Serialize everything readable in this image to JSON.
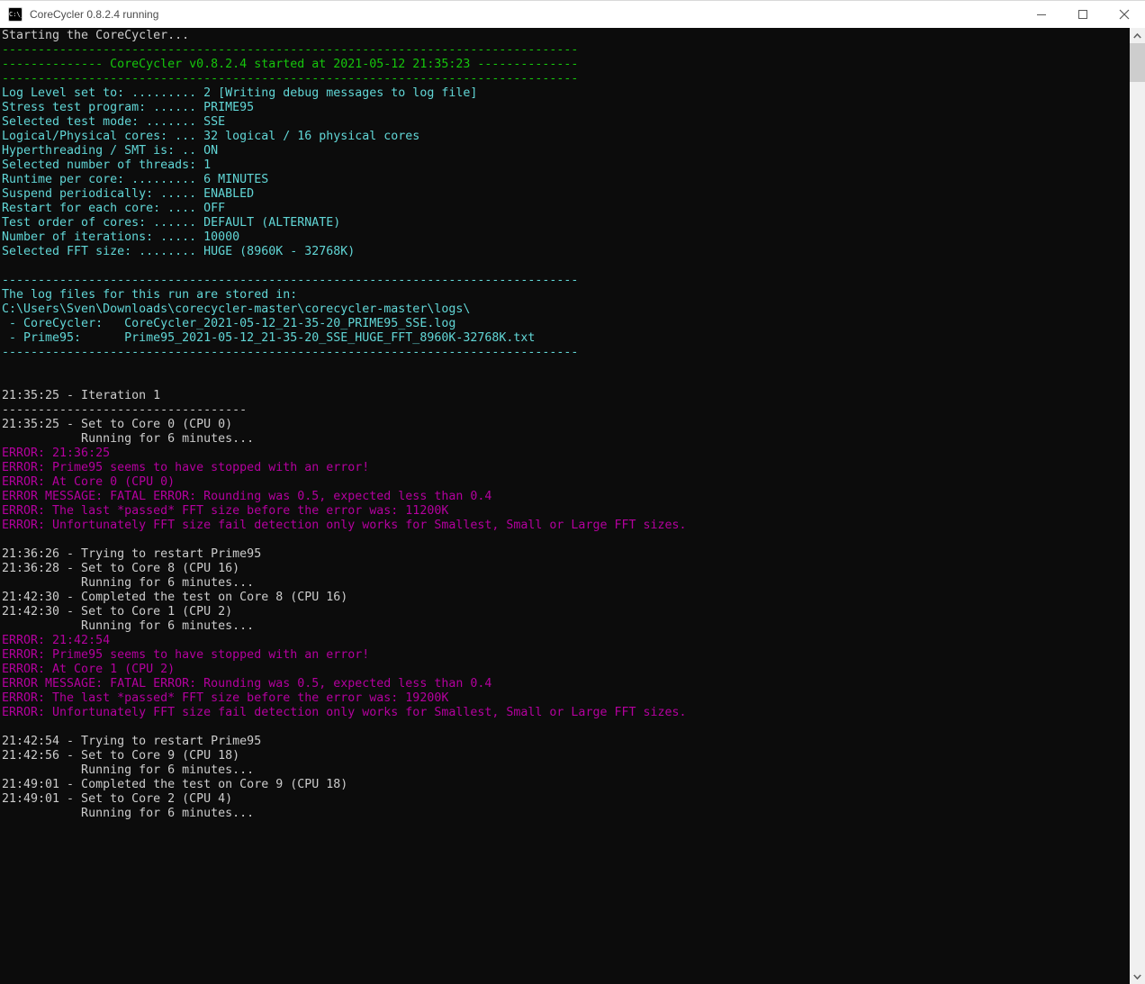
{
  "window": {
    "title": "CoreCycler 0.8.2.4 running",
    "icons": [
      "console-icon",
      "minimize-icon",
      "maximize-icon",
      "close-icon"
    ],
    "icon_label": "C:\\_"
  },
  "palette": {
    "background": "#0c0c0c",
    "titlebar_bg": "#ffffff",
    "title_text": "#4c4c4c",
    "white": "#cccccc",
    "green": "#16c60c",
    "cyan": "#61d6d6",
    "magenta": "#b4009e",
    "scrollbar_track": "#f0f0f0",
    "scrollbar_thumb": "#cdcdcd",
    "scrollbar_arrow": "#606060"
  },
  "console": {
    "lines": [
      {
        "color": "white",
        "text": "Starting the CoreCycler..."
      },
      {
        "color": "green",
        "text": "--------------------------------------------------------------------------------"
      },
      {
        "color": "green",
        "text": "-------------- CoreCycler v0.8.2.4 started at 2021-05-12 21:35:23 --------------"
      },
      {
        "color": "green",
        "text": "--------------------------------------------------------------------------------"
      },
      {
        "color": "cyan",
        "text": "Log Level set to: ......... 2 [Writing debug messages to log file]"
      },
      {
        "color": "cyan",
        "text": "Stress test program: ...... PRIME95"
      },
      {
        "color": "cyan",
        "text": "Selected test mode: ....... SSE"
      },
      {
        "color": "cyan",
        "text": "Logical/Physical cores: ... 32 logical / 16 physical cores"
      },
      {
        "color": "cyan",
        "text": "Hyperthreading / SMT is: .. ON"
      },
      {
        "color": "cyan",
        "text": "Selected number of threads: 1"
      },
      {
        "color": "cyan",
        "text": "Runtime per core: ......... 6 MINUTES"
      },
      {
        "color": "cyan",
        "text": "Suspend periodically: ..... ENABLED"
      },
      {
        "color": "cyan",
        "text": "Restart for each core: .... OFF"
      },
      {
        "color": "cyan",
        "text": "Test order of cores: ...... DEFAULT (ALTERNATE)"
      },
      {
        "color": "cyan",
        "text": "Number of iterations: ..... 10000"
      },
      {
        "color": "cyan",
        "text": "Selected FFT size: ........ HUGE (8960K - 32768K)"
      },
      {
        "color": "white",
        "text": ""
      },
      {
        "color": "cyan",
        "text": "--------------------------------------------------------------------------------"
      },
      {
        "color": "cyan",
        "text": "The log files for this run are stored in:"
      },
      {
        "color": "cyan",
        "text": "C:\\Users\\Sven\\Downloads\\corecycler-master\\corecycler-master\\logs\\"
      },
      {
        "color": "cyan",
        "text": " - CoreCycler:   CoreCycler_2021-05-12_21-35-20_PRIME95_SSE.log"
      },
      {
        "color": "cyan",
        "text": " - Prime95:      Prime95_2021-05-12_21-35-20_SSE_HUGE_FFT_8960K-32768K.txt"
      },
      {
        "color": "cyan",
        "text": "--------------------------------------------------------------------------------"
      },
      {
        "color": "white",
        "text": ""
      },
      {
        "color": "white",
        "text": ""
      },
      {
        "color": "white",
        "text": "21:35:25 - Iteration 1"
      },
      {
        "color": "white",
        "text": "----------------------------------"
      },
      {
        "color": "white",
        "text": "21:35:25 - Set to Core 0 (CPU 0)"
      },
      {
        "color": "white",
        "text": "           Running for 6 minutes..."
      },
      {
        "color": "magenta",
        "text": "ERROR: 21:36:25"
      },
      {
        "color": "magenta",
        "text": "ERROR: Prime95 seems to have stopped with an error!"
      },
      {
        "color": "magenta",
        "text": "ERROR: At Core 0 (CPU 0)"
      },
      {
        "color": "magenta",
        "text": "ERROR MESSAGE: FATAL ERROR: Rounding was 0.5, expected less than 0.4"
      },
      {
        "color": "magenta",
        "text": "ERROR: The last *passed* FFT size before the error was: 11200K"
      },
      {
        "color": "magenta",
        "text": "ERROR: Unfortunately FFT size fail detection only works for Smallest, Small or Large FFT sizes."
      },
      {
        "color": "white",
        "text": ""
      },
      {
        "color": "white",
        "text": "21:36:26 - Trying to restart Prime95"
      },
      {
        "color": "white",
        "text": "21:36:28 - Set to Core 8 (CPU 16)"
      },
      {
        "color": "white",
        "text": "           Running for 6 minutes..."
      },
      {
        "color": "white",
        "text": "21:42:30 - Completed the test on Core 8 (CPU 16)"
      },
      {
        "color": "white",
        "text": "21:42:30 - Set to Core 1 (CPU 2)"
      },
      {
        "color": "white",
        "text": "           Running for 6 minutes..."
      },
      {
        "color": "magenta",
        "text": "ERROR: 21:42:54"
      },
      {
        "color": "magenta",
        "text": "ERROR: Prime95 seems to have stopped with an error!"
      },
      {
        "color": "magenta",
        "text": "ERROR: At Core 1 (CPU 2)"
      },
      {
        "color": "magenta",
        "text": "ERROR MESSAGE: FATAL ERROR: Rounding was 0.5, expected less than 0.4"
      },
      {
        "color": "magenta",
        "text": "ERROR: The last *passed* FFT size before the error was: 19200K"
      },
      {
        "color": "magenta",
        "text": "ERROR: Unfortunately FFT size fail detection only works for Smallest, Small or Large FFT sizes."
      },
      {
        "color": "white",
        "text": ""
      },
      {
        "color": "white",
        "text": "21:42:54 - Trying to restart Prime95"
      },
      {
        "color": "white",
        "text": "21:42:56 - Set to Core 9 (CPU 18)"
      },
      {
        "color": "white",
        "text": "           Running for 6 minutes..."
      },
      {
        "color": "white",
        "text": "21:49:01 - Completed the test on Core 9 (CPU 18)"
      },
      {
        "color": "white",
        "text": "21:49:01 - Set to Core 2 (CPU 4)"
      },
      {
        "color": "white",
        "text": "           Running for 6 minutes..."
      }
    ]
  }
}
